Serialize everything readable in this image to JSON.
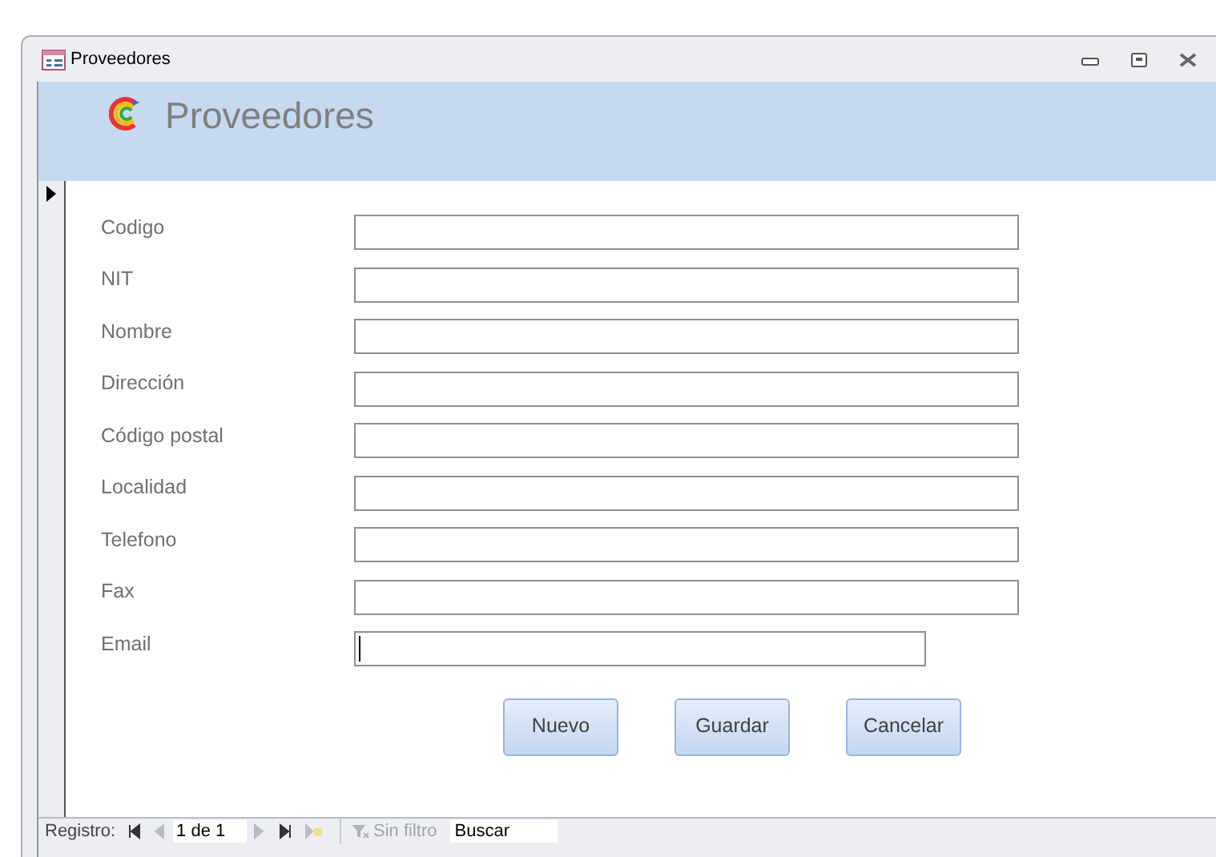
{
  "window": {
    "title": "Proveedores"
  },
  "header": {
    "title": "Proveedores"
  },
  "fields": [
    {
      "label": "Codigo",
      "kind": "wide",
      "focused": false
    },
    {
      "label": "NIT",
      "kind": "wide",
      "focused": false
    },
    {
      "label": "Nombre",
      "kind": "wide",
      "focused": false
    },
    {
      "label": "Dirección",
      "kind": "wide",
      "focused": false
    },
    {
      "label": "Código postal",
      "kind": "wide",
      "focused": false
    },
    {
      "label": "Localidad",
      "kind": "wide",
      "focused": false
    },
    {
      "label": "Telefono",
      "kind": "wide",
      "focused": false
    },
    {
      "label": "Fax",
      "kind": "wide",
      "focused": false
    },
    {
      "label": "Email",
      "kind": "narrow",
      "focused": true
    }
  ],
  "buttons": [
    "Nuevo",
    "Guardar",
    "Cancelar"
  ],
  "status_bar": {
    "label": "Registro:",
    "nav": [
      {
        "kind": "first",
        "disabled": false
      },
      {
        "kind": "prev",
        "disabled": true
      }
    ],
    "position": "1 de 1",
    "nav_after": [
      {
        "kind": "next",
        "disabled": true
      },
      {
        "kind": "last",
        "disabled": false
      },
      {
        "kind": "new",
        "disabled": true
      }
    ],
    "filter": "Sin filtro",
    "search": "Buscar"
  }
}
